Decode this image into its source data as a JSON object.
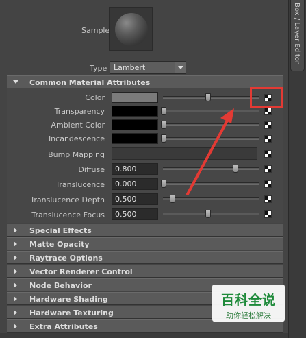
{
  "side_tab": {
    "label": "Box / Layer Editor"
  },
  "sample": {
    "label": "Sample"
  },
  "type": {
    "label": "Type",
    "value": "Lambert"
  },
  "common": {
    "header": "Common Material Attributes",
    "rows": {
      "color": {
        "label": "Color",
        "swatch": "#7b7b7b",
        "level": 0.5
      },
      "transparency": {
        "label": "Transparency",
        "swatch": "#000000",
        "level": 0.0
      },
      "ambient": {
        "label": "Ambient Color",
        "swatch": "#000000",
        "level": 0.0
      },
      "incandescence": {
        "label": "Incandescence",
        "swatch": "#000000",
        "level": 0.0
      },
      "bump": {
        "label": "Bump Mapping"
      },
      "diffuse": {
        "label": "Diffuse",
        "value": "0.800"
      },
      "translucence": {
        "label": "Translucence",
        "value": "0.000"
      },
      "translucence_depth": {
        "label": "Translucence Depth",
        "value": "0.500"
      },
      "translucence_focus": {
        "label": "Translucence Focus",
        "value": "0.500"
      }
    }
  },
  "sections": {
    "special_effects": "Special Effects",
    "matte_opacity": "Matte Opacity",
    "raytrace_options": "Raytrace Options",
    "vector_renderer": "Vector Renderer Control",
    "node_behavior": "Node Behavior",
    "hardware_shading": "Hardware Shading",
    "hardware_texturing": "Hardware Texturing",
    "extra_attributes": "Extra Attributes"
  },
  "watermark": {
    "title": "百科全说",
    "subtitle": "助你轻松解决"
  },
  "colors": {
    "highlight": "#e23a34",
    "panel": "#444444",
    "header": "#5a5a5a"
  }
}
